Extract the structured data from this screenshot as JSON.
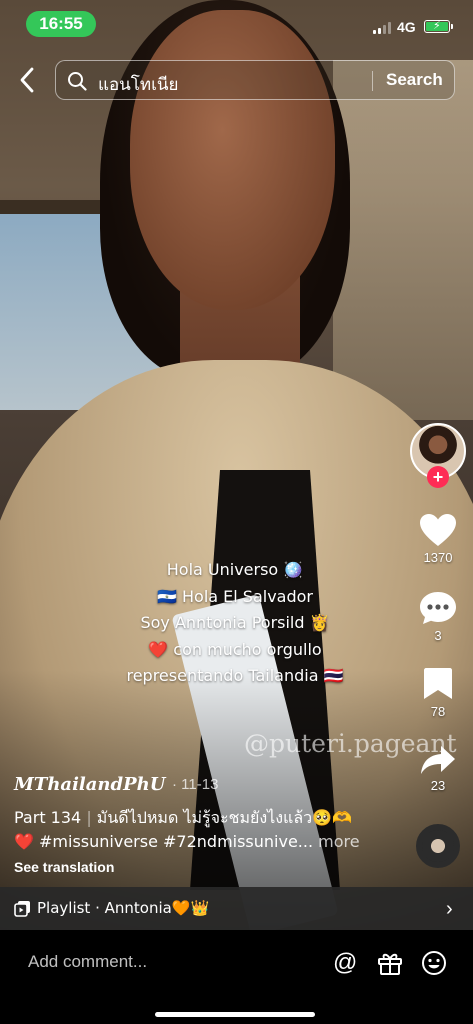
{
  "status_bar": {
    "time": "16:55",
    "network": "4G",
    "accent": "#34c759"
  },
  "search": {
    "query": "แอนโทเนีย",
    "button_label": "Search"
  },
  "video": {
    "caption_lines": [
      "Hola Universo 🪩",
      "🇸🇻 Hola El Salvador",
      "Soy Anntonia Porsild 👸",
      "❤️ con mucho orgullo",
      "representando Tailandia 🇹🇭"
    ],
    "watermark": "@puteri.pageant"
  },
  "rail": {
    "like_count": "1370",
    "comment_count": "3",
    "save_count": "78",
    "share_count": "23",
    "follow_color": "#fe2c55"
  },
  "post": {
    "username": "MThailandPhU",
    "date": "· 11-13",
    "part": "Part 134",
    "separator": "|",
    "thai_text": "มันดีไปหมด ไม่รู้จะชมยังไงแล้ว🥺🫶",
    "tags": "❤️ #missuniverse #72ndmissunive...",
    "more_label": "more",
    "see_translation": "See translation"
  },
  "playlist": {
    "label": "Playlist · Anntonia🧡👑"
  },
  "comment_bar": {
    "placeholder": "Add comment..."
  }
}
